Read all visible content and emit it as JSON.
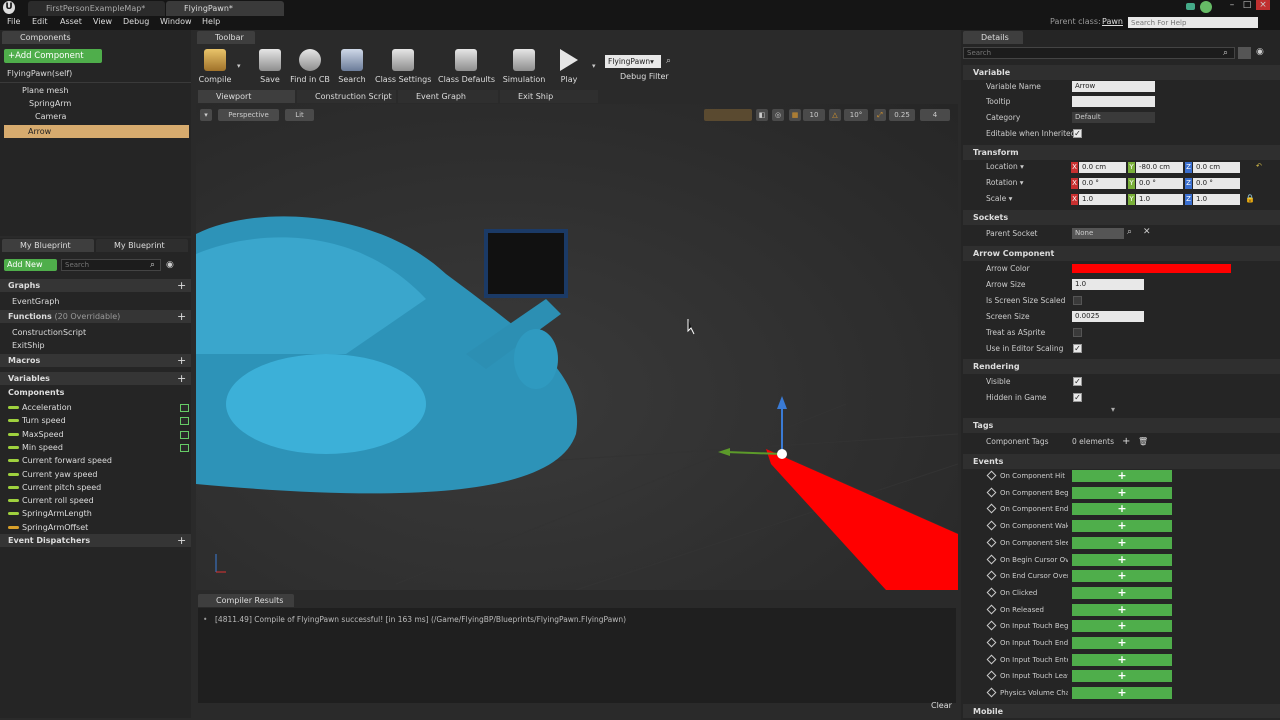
{
  "window": {
    "doc_tabs": [
      "FirstPersonExampleMap*",
      "FlyingPawn*"
    ],
    "parent_class_label": "Parent class:",
    "parent_class_value": "Pawn",
    "help_search_placeholder": "Search For Help"
  },
  "menu": [
    "File",
    "Edit",
    "Asset",
    "View",
    "Debug",
    "Window",
    "Help"
  ],
  "components_panel": {
    "tab": "Components",
    "add_button": "+Add Component",
    "self_label": "FlyingPawn(self)",
    "tree": [
      "Plane mesh",
      "SpringArm",
      "Camera",
      "Arrow"
    ]
  },
  "my_blueprint": {
    "tabs": [
      "My Blueprint",
      "My Blueprint"
    ],
    "add_new": "Add New",
    "search_placeholder": "Search",
    "graphs_label": "Graphs",
    "graphs": [
      "EventGraph"
    ],
    "functions_label": "Functions",
    "functions_note": "(20 Overridable)",
    "functions": [
      "ConstructionScript",
      "ExitShip"
    ],
    "macros_label": "Macros",
    "variables_label": "Variables",
    "components_label": "Components",
    "variables": [
      {
        "name": "Acceleration",
        "color": "#9fd13e",
        "public": true
      },
      {
        "name": "Turn speed",
        "color": "#9fd13e",
        "public": true
      },
      {
        "name": "MaxSpeed",
        "color": "#9fd13e",
        "public": true
      },
      {
        "name": "Min speed",
        "color": "#9fd13e",
        "public": true
      },
      {
        "name": "Current forward speed",
        "color": "#9fd13e",
        "public": false
      },
      {
        "name": "Current yaw speed",
        "color": "#9fd13e",
        "public": false
      },
      {
        "name": "Current pitch speed",
        "color": "#9fd13e",
        "public": false
      },
      {
        "name": "Current roll speed",
        "color": "#9fd13e",
        "public": false
      },
      {
        "name": "SpringArmLength",
        "color": "#9fd13e",
        "public": false
      },
      {
        "name": "SpringArmOffset",
        "color": "#d8a02a",
        "public": false
      }
    ],
    "event_dispatchers_label": "Event Dispatchers"
  },
  "toolbar": {
    "tab": "Toolbar",
    "buttons": [
      "Compile",
      "Save",
      "Find in CB",
      "Search",
      "Class Settings",
      "Class Defaults",
      "Simulation",
      "Play"
    ],
    "debug_object": "FlyingPawn",
    "debug_filter_label": "Debug Filter"
  },
  "editor_tabs": [
    "Viewport",
    "Construction Script",
    "Event Graph",
    "Exit Ship"
  ],
  "viewport": {
    "perspective": "Perspective",
    "lit": "Lit",
    "snap_grid": "10",
    "snap_rot": "10°",
    "snap_scale": "0.25",
    "camera_speed": "4"
  },
  "compiler": {
    "tab": "Compiler Results",
    "message": "[4811.49] Compile of FlyingPawn successful! [in 163 ms] (/Game/FlyingBP/Blueprints/FlyingPawn.FlyingPawn)",
    "clear": "Clear"
  },
  "details": {
    "tab": "Details",
    "search_placeholder": "Search",
    "variable": {
      "header": "Variable",
      "name_label": "Variable Name",
      "name_value": "Arrow",
      "tooltip_label": "Tooltip",
      "tooltip_value": "",
      "category_label": "Category",
      "category_value": "Default",
      "editable_label": "Editable when Inherited"
    },
    "transform": {
      "header": "Transform",
      "location_label": "Location",
      "location": [
        "0.0 cm",
        "-80.0 cm",
        "0.0 cm"
      ],
      "rotation_label": "Rotation",
      "rotation": [
        "0.0 °",
        "0.0 °",
        "0.0 °"
      ],
      "scale_label": "Scale",
      "scale": [
        "1.0",
        "1.0",
        "1.0"
      ]
    },
    "sockets": {
      "header": "Sockets",
      "parent_socket_label": "Parent Socket",
      "parent_socket_value": "None"
    },
    "arrow_component": {
      "header": "Arrow Component",
      "arrow_color_label": "Arrow Color",
      "arrow_color": "#ff0000",
      "arrow_size_label": "Arrow Size",
      "arrow_size": "1.0",
      "screen_size_scaled_label": "Is Screen Size Scaled",
      "screen_size_label": "Screen Size",
      "screen_size": "0.0025",
      "treat_sprite_label": "Treat as ASprite",
      "editor_scaling_label": "Use in Editor Scaling"
    },
    "rendering": {
      "header": "Rendering",
      "visible_label": "Visible",
      "hidden_label": "Hidden in Game"
    },
    "tags": {
      "header": "Tags",
      "component_tags_label": "Component Tags",
      "component_tags_value": "0 elements"
    },
    "events": {
      "header": "Events",
      "items": [
        "On Component Hit",
        "On Component Begi",
        "On Component End (",
        "On Component Wak",
        "On Component Slee",
        "On Begin Cursor Ove",
        "On End Cursor Over",
        "On Clicked",
        "On Released",
        "On Input Touch Begi",
        "On Input Touch End",
        "On Input Touch Ente",
        "On Input Touch Leav",
        "Physics Volume Cha"
      ]
    },
    "mobile": {
      "header": "Mobile"
    }
  }
}
